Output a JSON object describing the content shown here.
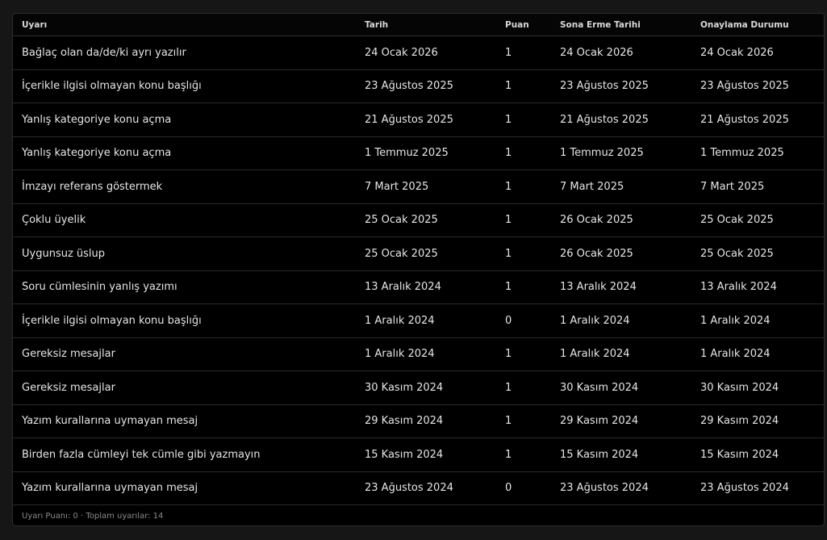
{
  "table": {
    "headers": [
      "Uyarı",
      "Tarih",
      "Puan",
      "Sona Erme Tarihi",
      "Onaylama Durumu"
    ],
    "rows": [
      [
        "Bağlaç olan da/de/ki ayrı yazılır",
        "24 Ocak 2026",
        "1",
        "24 Ocak 2026",
        "24 Ocak 2026"
      ],
      [
        "İçerikle ilgisi olmayan konu başlığı",
        "23 Ağustos 2025",
        "1",
        "23 Ağustos 2025",
        "23 Ağustos 2025"
      ],
      [
        "Yanlış kategoriye konu açma",
        "21 Ağustos 2025",
        "1",
        "21 Ağustos 2025",
        "21 Ağustos 2025"
      ],
      [
        "Yanlış kategoriye konu açma",
        "1 Temmuz 2025",
        "1",
        "1 Temmuz 2025",
        "1 Temmuz 2025"
      ],
      [
        "İmzayı referans göstermek",
        "7 Mart 2025",
        "1",
        "7 Mart 2025",
        "7 Mart 2025"
      ],
      [
        "Çoklu üyelik",
        "25 Ocak 2025",
        "1",
        "26 Ocak 2025",
        "25 Ocak 2025"
      ],
      [
        "Uygunsuz üslup",
        "25 Ocak 2025",
        "1",
        "26 Ocak 2025",
        "25 Ocak 2025"
      ],
      [
        "Soru cümlesinin yanlış yazımı",
        "13 Aralık 2024",
        "1",
        "13 Aralık 2024",
        "13 Aralık 2024"
      ],
      [
        "İçerikle ilgisi olmayan konu başlığı",
        "1 Aralık 2024",
        "0",
        "1 Aralık 2024",
        "1 Aralık 2024"
      ],
      [
        "Gereksiz mesajlar",
        "1 Aralık 2024",
        "1",
        "1 Aralık 2024",
        "1 Aralık 2024"
      ],
      [
        "Gereksiz mesajlar",
        "30 Kasım 2024",
        "1",
        "30 Kasım 2024",
        "30 Kasım 2024"
      ],
      [
        "Yazım kurallarına uymayan mesaj",
        "29 Kasım 2024",
        "1",
        "29 Kasım 2024",
        "29 Kasım 2024"
      ],
      [
        "Birden fazla cümleyi tek cümle gibi yazmayın",
        "15 Kasım 2024",
        "1",
        "15 Kasım 2024",
        "15 Kasım 2024"
      ],
      [
        "Yazım kurallarına uymayan mesaj",
        "23 Ağustos 2024",
        "0",
        "23 Ağustos 2024",
        "23 Ağustos 2024"
      ]
    ]
  },
  "footer": {
    "summary": "Uyarı Puanı: 0 · Toplam uyarılar: 14"
  },
  "colors": {
    "background": "#161616",
    "panel": "#000000",
    "border": "#2e2e2e",
    "text": "#e6e6e6",
    "muted": "#8a8a8a"
  }
}
